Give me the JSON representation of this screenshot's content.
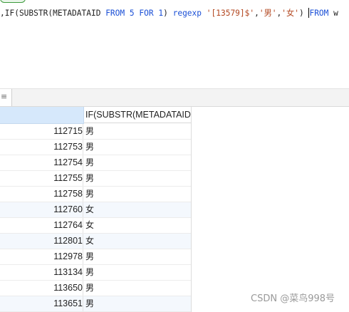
{
  "editor": {
    "sql_tokens": [
      {
        "text": ",IF(SUBSTR(METADATAID ",
        "cls": ""
      },
      {
        "text": "FROM",
        "cls": "kw"
      },
      {
        "text": " ",
        "cls": ""
      },
      {
        "text": "5",
        "cls": "num"
      },
      {
        "text": " ",
        "cls": ""
      },
      {
        "text": "FOR",
        "cls": "kw"
      },
      {
        "text": " ",
        "cls": ""
      },
      {
        "text": "1",
        "cls": "num"
      },
      {
        "text": ") ",
        "cls": ""
      },
      {
        "text": "regexp",
        "cls": "kw"
      },
      {
        "text": " ",
        "cls": ""
      },
      {
        "text": "'[13579]$'",
        "cls": "str"
      },
      {
        "text": ",",
        "cls": ""
      },
      {
        "text": "'男'",
        "cls": "str"
      },
      {
        "text": ",",
        "cls": ""
      },
      {
        "text": "'女'",
        "cls": "str"
      },
      {
        "text": ") ",
        "cls": ""
      },
      {
        "text": "CARET",
        "cls": "caret"
      },
      {
        "text": "FROM",
        "cls": "kw"
      },
      {
        "text": " w",
        "cls": ""
      }
    ]
  },
  "results": {
    "columns": [
      "",
      "IF(SUBSTR(METADATAID"
    ],
    "rows": [
      {
        "id": "112715",
        "gender": "男"
      },
      {
        "id": "112753",
        "gender": "男"
      },
      {
        "id": "112754",
        "gender": "男"
      },
      {
        "id": "112755",
        "gender": "男"
      },
      {
        "id": "112758",
        "gender": "男"
      },
      {
        "id": "112760",
        "gender": "女"
      },
      {
        "id": "112764",
        "gender": "女"
      },
      {
        "id": "112801",
        "gender": "女"
      },
      {
        "id": "112978",
        "gender": "男"
      },
      {
        "id": "113134",
        "gender": "男"
      },
      {
        "id": "113650",
        "gender": "男"
      },
      {
        "id": "113651",
        "gender": "男"
      }
    ],
    "highlighted_rows": [
      5,
      7,
      11
    ]
  },
  "tab": {
    "glyph": "≡"
  },
  "watermark": "CSDN @菜鸟998号"
}
